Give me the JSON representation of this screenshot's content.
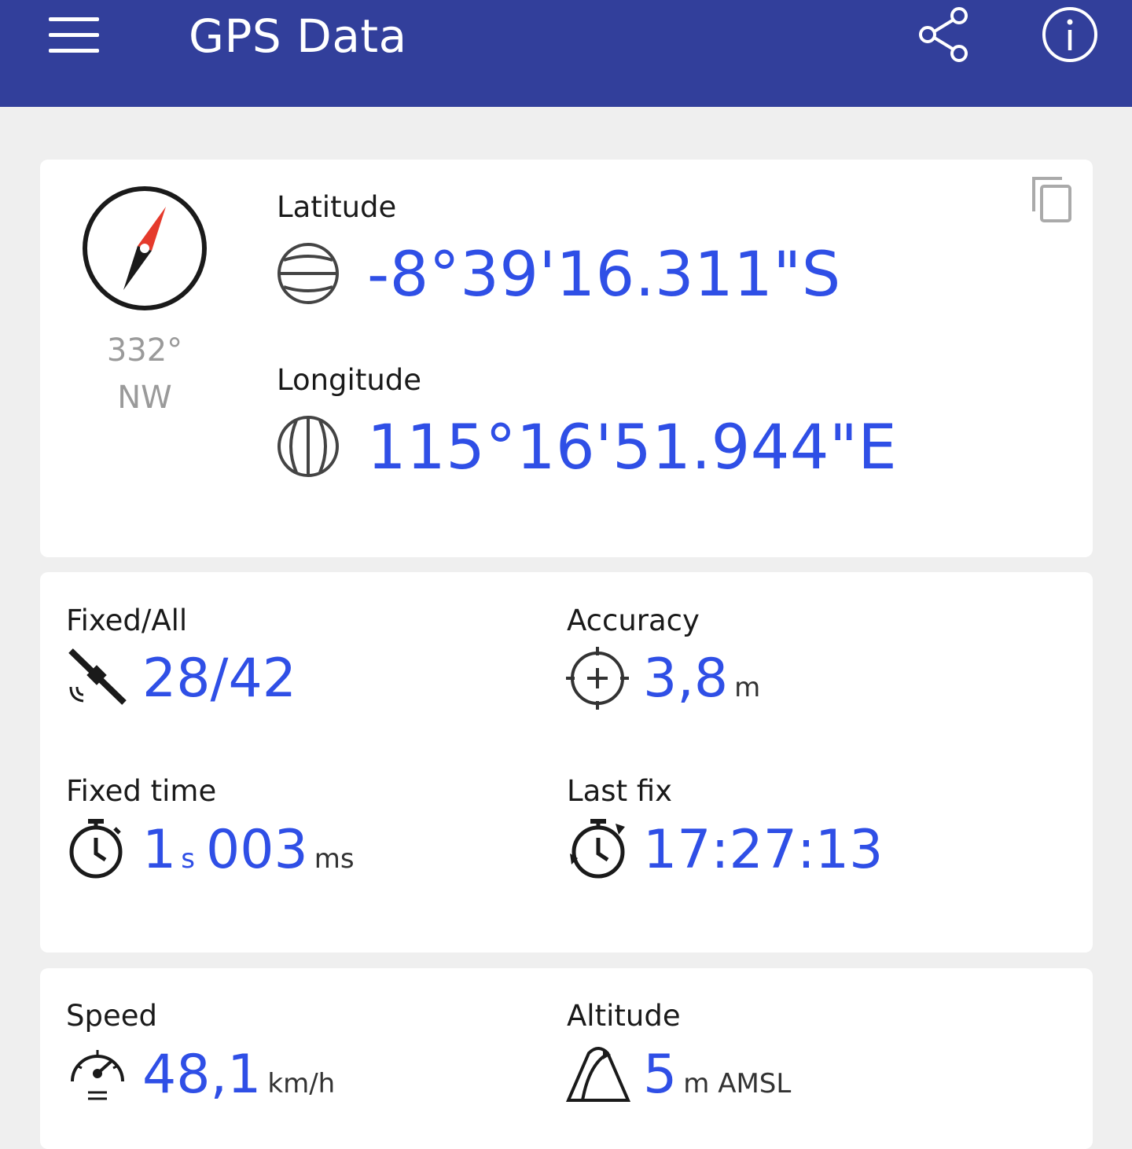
{
  "appbar": {
    "title": "GPS Data",
    "bg_color": "#323f9b",
    "icons": [
      "menu-icon",
      "share-icon",
      "info-icon"
    ]
  },
  "location": {
    "heading_degrees": "332°",
    "heading_direction": "NW",
    "latitude_label": "Latitude",
    "latitude_value": "-8°39'16.311\"S",
    "longitude_label": "Longitude",
    "longitude_value": "115°16'51.944\"E"
  },
  "fix": {
    "fixed_all_label": "Fixed/All",
    "fixed_all_value": "28/42",
    "accuracy_label": "Accuracy",
    "accuracy_value": "3,8",
    "accuracy_unit": "m",
    "fixed_time_label": "Fixed time",
    "fixed_time_seconds": "1",
    "fixed_time_seconds_unit": "s",
    "fixed_time_ms": "003",
    "fixed_time_ms_unit": "ms",
    "last_fix_label": "Last fix",
    "last_fix_value": "17:27:13"
  },
  "motion": {
    "speed_label": "Speed",
    "speed_value": "48,1",
    "speed_unit": "km/h",
    "altitude_label": "Altitude",
    "altitude_value": "5",
    "altitude_unit": "m AMSL"
  },
  "colors": {
    "accent_value": "#2f4fe6",
    "compass_needle_north": "#e53a2c",
    "background": "#efefef"
  }
}
